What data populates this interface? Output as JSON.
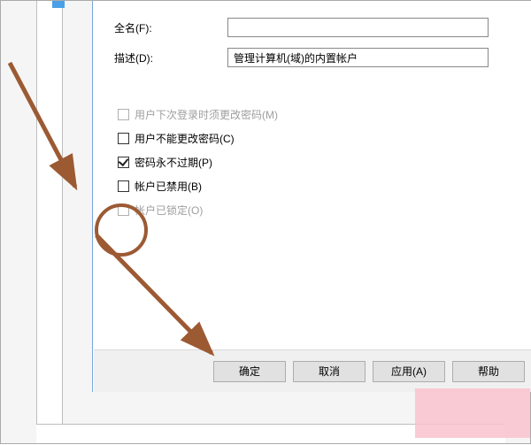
{
  "labels": {
    "fullName": "全名(F):",
    "description": "描述(D):"
  },
  "values": {
    "fullName": "",
    "description": "管理计算机(域)的内置帐户"
  },
  "checkboxes": {
    "mustChange": {
      "label": "用户下次登录时须更改密码(M)",
      "checked": false,
      "disabled": true
    },
    "cannotChange": {
      "label": "用户不能更改密码(C)",
      "checked": false,
      "disabled": false
    },
    "neverExpire": {
      "label": "密码永不过期(P)",
      "checked": true,
      "disabled": false
    },
    "disabled": {
      "label": "帐户已禁用(B)",
      "checked": false,
      "disabled": false
    },
    "locked": {
      "label": "帐户已锁定(O)",
      "checked": false,
      "disabled": true
    }
  },
  "buttons": {
    "ok": "确定",
    "cancel": "取消",
    "apply": "应用(A)",
    "help": "帮助"
  }
}
